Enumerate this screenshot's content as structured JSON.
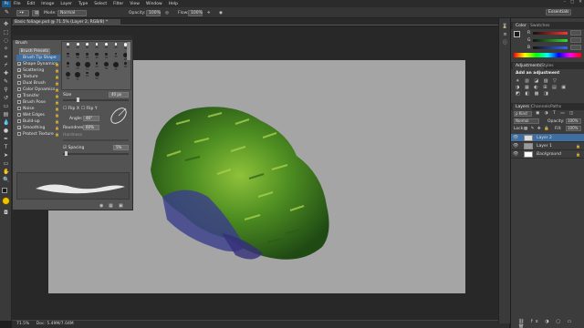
{
  "app": {
    "logo": "Ps"
  },
  "menu": [
    "File",
    "Edit",
    "Image",
    "Layer",
    "Type",
    "Select",
    "Filter",
    "View",
    "Window",
    "Help"
  ],
  "window_controls": [
    "–",
    "▢",
    "✕"
  ],
  "options_bar": {
    "mode_label": "Mode:",
    "mode_value": "Normal",
    "opacity_label": "Opacity:",
    "opacity_value": "100%",
    "flow_label": "Flow:",
    "flow_value": "100%",
    "workspace": "Essentials"
  },
  "document_tab": "Basic foliage.psd @ 71.5% (Layer 2, RGB/8) *",
  "brush_panel": {
    "tabs": [
      "Brush"
    ],
    "presets_button": "Brush Presets",
    "options": [
      {
        "label": "Brush Tip Shape",
        "checked": false,
        "selected": true
      },
      {
        "label": "Shape Dynamics",
        "checked": true
      },
      {
        "label": "Scattering",
        "checked": true
      },
      {
        "label": "Texture",
        "checked": false
      },
      {
        "label": "Dual Brush",
        "checked": false
      },
      {
        "label": "Color Dynamics",
        "checked": false
      },
      {
        "label": "Transfer",
        "checked": true
      },
      {
        "label": "Brush Pose",
        "checked": false
      },
      {
        "label": "Noise",
        "checked": false
      },
      {
        "label": "Wet Edges",
        "checked": false
      },
      {
        "label": "Build-up",
        "checked": false
      },
      {
        "label": "Smoothing",
        "checked": true
      },
      {
        "label": "Protect Texture",
        "checked": false
      }
    ],
    "tip_sizes": [
      "30",
      "30",
      "30",
      "25",
      "25",
      "25",
      "36",
      "25",
      "36",
      "36",
      "36",
      "32",
      "25",
      "50",
      "25",
      "50",
      "71",
      "25",
      "50",
      "71",
      "25",
      "50",
      "71",
      "25",
      "50"
    ],
    "size_label": "Size",
    "size_value": "40 px",
    "flip_x": "Flip X",
    "flip_y": "Flip Y",
    "angle_label": "Angle:",
    "angle_value": "46°",
    "roundness_label": "Roundness:",
    "roundness_value": "60%",
    "hardness_label": "Hardness",
    "spacing_label": "Spacing",
    "spacing_value": "5%"
  },
  "right_panels": {
    "color_tabs": [
      "Color",
      "Swatches"
    ],
    "color_sliders": [
      {
        "label": "R",
        "value": "",
        "color": "#ff3333"
      },
      {
        "label": "G",
        "value": "",
        "color": "#33dd33"
      },
      {
        "label": "B",
        "value": "",
        "color": "#3366ff"
      }
    ],
    "adjust_tabs": [
      "Adjustments",
      "Styles"
    ],
    "adjust_heading": "Add an adjustment",
    "layers_tabs": [
      "Layers",
      "Channels",
      "Paths"
    ],
    "kind_label": "Kind",
    "blend_mode": "Normal",
    "opacity_label": "Opacity:",
    "opacity_value": "100%",
    "lock_label": "Lock:",
    "fill_label": "Fill:",
    "fill_value": "100%",
    "layers": [
      {
        "name": "Layer 2",
        "selected": true
      },
      {
        "name": "Layer 1",
        "selected": false
      },
      {
        "name": "Background",
        "selected": false
      }
    ]
  },
  "status": {
    "zoom": "71.5%",
    "doc": "Doc: 5.49M/7.04M"
  },
  "colors": {
    "foreground": "#1a1a1a",
    "background": "#ffffff",
    "selection": "#3f6ea0",
    "canvas": "#a5a5a5"
  }
}
